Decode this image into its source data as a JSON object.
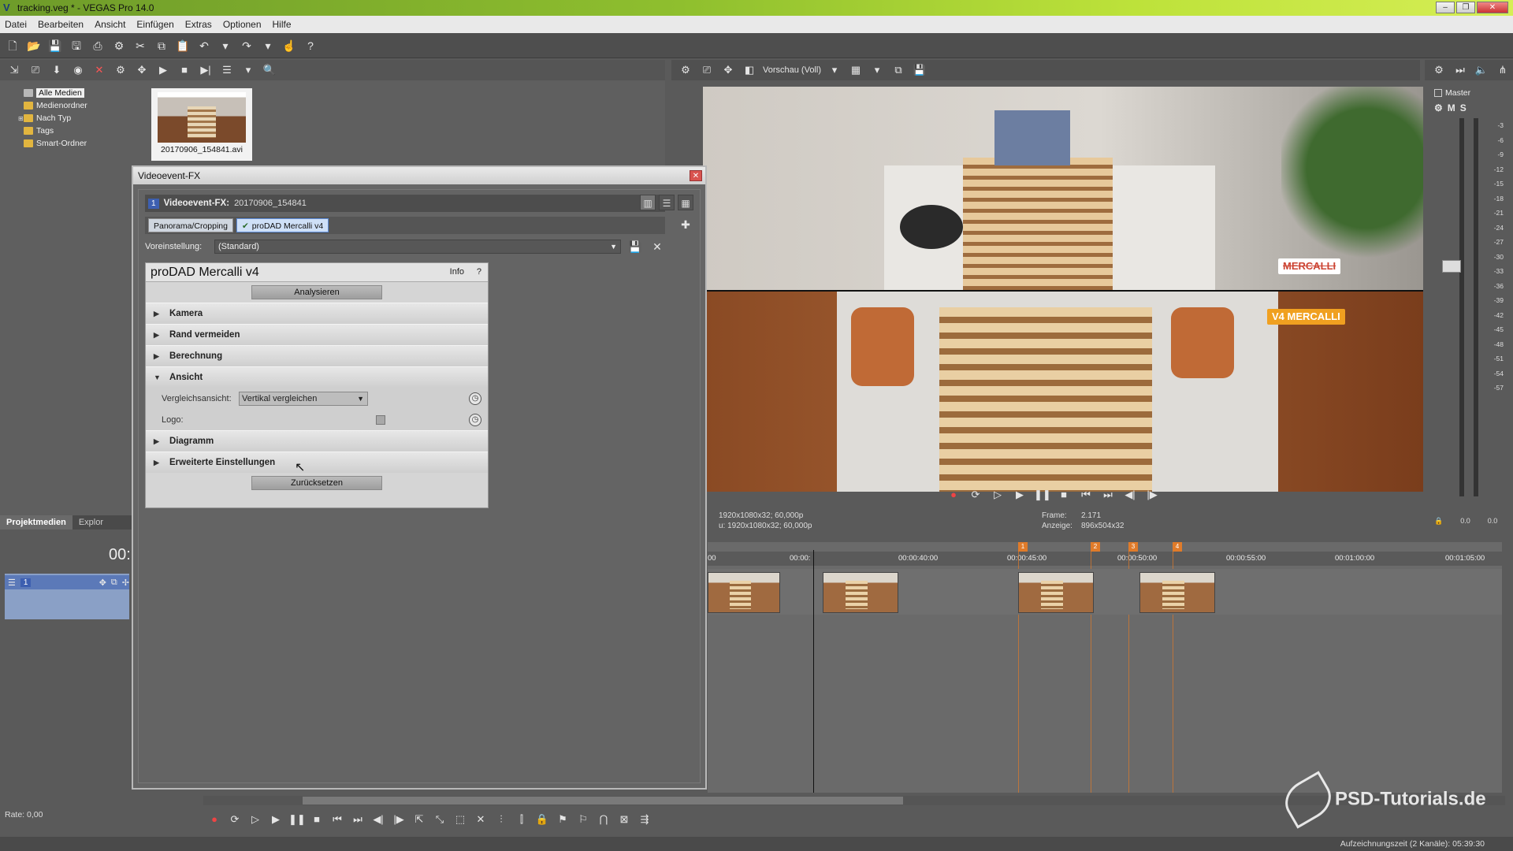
{
  "window": {
    "title": "tracking.veg * - VEGAS Pro 14.0"
  },
  "menu": [
    "Datei",
    "Bearbeiten",
    "Ansicht",
    "Einfügen",
    "Extras",
    "Optionen",
    "Hilfe"
  ],
  "media_tree": {
    "items": [
      {
        "label": "Alle Medien",
        "selected": true
      },
      {
        "label": "Medienordner"
      },
      {
        "label": "Nach Typ",
        "expandable": true
      },
      {
        "label": "Tags"
      },
      {
        "label": "Smart-Ordner"
      }
    ]
  },
  "media_file": {
    "name": "20170906_154841.avi"
  },
  "bottom_tabs": [
    "Projektmedien",
    "Explor"
  ],
  "fx_dialog": {
    "title": "Videoevent-FX",
    "close_glyph": "✕",
    "header_num": "1",
    "header_label": "Videoevent-FX:",
    "header_value": "20170906_154841",
    "chain": [
      "Panorama/Cropping",
      "proDAD Mercalli v4"
    ],
    "preset_label": "Voreinstellung:",
    "preset_value": "(Standard)"
  },
  "mercalli": {
    "title": "proDAD Mercalli v4",
    "info": "Info",
    "help": "?",
    "analyze": "Analysieren",
    "sections": {
      "kamera": "Kamera",
      "rand": "Rand vermeiden",
      "berechnung": "Berechnung",
      "ansicht": "Ansicht",
      "diagramm": "Diagramm",
      "erweitert": "Erweiterte Einstellungen"
    },
    "compare_label": "Vergleichsansicht:",
    "compare_value": "Vertikal vergleichen",
    "logo_label": "Logo:",
    "reset": "Zurücksetzen"
  },
  "preview": {
    "mode": "Vorschau (Voll)",
    "badge_off": "MERCALLI",
    "badge_on_prefix": "V4",
    "badge_on": "MERCALLI",
    "project_line": "1920x1080x32; 60,000p",
    "preview_line_prefix": "u:",
    "preview_line": "1920x1080x32; 60,000p",
    "frame_label": "Frame:",
    "frame_value": "2.171",
    "display_label": "Anzeige:",
    "display_value": "896x504x32"
  },
  "master": {
    "label": "Master",
    "m": "M",
    "s": "S",
    "scale": [
      "-3",
      "-6",
      "-9",
      "-12",
      "-15",
      "-18",
      "-21",
      "-24",
      "-27",
      "-30",
      "-33",
      "-36",
      "-39",
      "-42",
      "-45",
      "-48",
      "-51",
      "-54",
      "-57"
    ],
    "foot": [
      "0.0",
      "0.0"
    ]
  },
  "timeline": {
    "timecode": "00:",
    "ruler": [
      "00",
      "00:00:",
      "00:00:40:00",
      "00:00:45:00",
      "00:00:50:00",
      "00:00:55:00",
      "00:01:00:00",
      "00:01:05:00"
    ],
    "markers": [
      "1",
      "2",
      "3",
      "4"
    ],
    "track_num": "1"
  },
  "rate": "Rate: 0,00",
  "status": {
    "record_time": "Aufzeichnungszeit (2 Kanäle): 05:39:30"
  },
  "watermark": "PSD-Tutorials.de"
}
